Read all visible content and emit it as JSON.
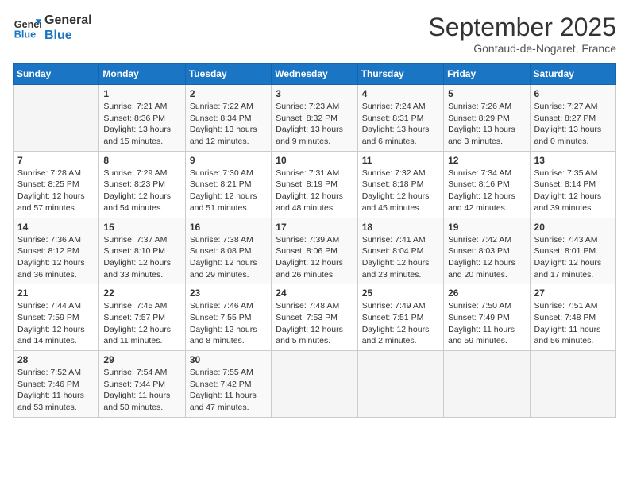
{
  "header": {
    "logo_line1": "General",
    "logo_line2": "Blue",
    "month": "September 2025",
    "location": "Gontaud-de-Nogaret, France"
  },
  "weekdays": [
    "Sunday",
    "Monday",
    "Tuesday",
    "Wednesday",
    "Thursday",
    "Friday",
    "Saturday"
  ],
  "weeks": [
    [
      {
        "day": "",
        "info": ""
      },
      {
        "day": "1",
        "info": "Sunrise: 7:21 AM\nSunset: 8:36 PM\nDaylight: 13 hours\nand 15 minutes."
      },
      {
        "day": "2",
        "info": "Sunrise: 7:22 AM\nSunset: 8:34 PM\nDaylight: 13 hours\nand 12 minutes."
      },
      {
        "day": "3",
        "info": "Sunrise: 7:23 AM\nSunset: 8:32 PM\nDaylight: 13 hours\nand 9 minutes."
      },
      {
        "day": "4",
        "info": "Sunrise: 7:24 AM\nSunset: 8:31 PM\nDaylight: 13 hours\nand 6 minutes."
      },
      {
        "day": "5",
        "info": "Sunrise: 7:26 AM\nSunset: 8:29 PM\nDaylight: 13 hours\nand 3 minutes."
      },
      {
        "day": "6",
        "info": "Sunrise: 7:27 AM\nSunset: 8:27 PM\nDaylight: 13 hours\nand 0 minutes."
      }
    ],
    [
      {
        "day": "7",
        "info": "Sunrise: 7:28 AM\nSunset: 8:25 PM\nDaylight: 12 hours\nand 57 minutes."
      },
      {
        "day": "8",
        "info": "Sunrise: 7:29 AM\nSunset: 8:23 PM\nDaylight: 12 hours\nand 54 minutes."
      },
      {
        "day": "9",
        "info": "Sunrise: 7:30 AM\nSunset: 8:21 PM\nDaylight: 12 hours\nand 51 minutes."
      },
      {
        "day": "10",
        "info": "Sunrise: 7:31 AM\nSunset: 8:19 PM\nDaylight: 12 hours\nand 48 minutes."
      },
      {
        "day": "11",
        "info": "Sunrise: 7:32 AM\nSunset: 8:18 PM\nDaylight: 12 hours\nand 45 minutes."
      },
      {
        "day": "12",
        "info": "Sunrise: 7:34 AM\nSunset: 8:16 PM\nDaylight: 12 hours\nand 42 minutes."
      },
      {
        "day": "13",
        "info": "Sunrise: 7:35 AM\nSunset: 8:14 PM\nDaylight: 12 hours\nand 39 minutes."
      }
    ],
    [
      {
        "day": "14",
        "info": "Sunrise: 7:36 AM\nSunset: 8:12 PM\nDaylight: 12 hours\nand 36 minutes."
      },
      {
        "day": "15",
        "info": "Sunrise: 7:37 AM\nSunset: 8:10 PM\nDaylight: 12 hours\nand 33 minutes."
      },
      {
        "day": "16",
        "info": "Sunrise: 7:38 AM\nSunset: 8:08 PM\nDaylight: 12 hours\nand 29 minutes."
      },
      {
        "day": "17",
        "info": "Sunrise: 7:39 AM\nSunset: 8:06 PM\nDaylight: 12 hours\nand 26 minutes."
      },
      {
        "day": "18",
        "info": "Sunrise: 7:41 AM\nSunset: 8:04 PM\nDaylight: 12 hours\nand 23 minutes."
      },
      {
        "day": "19",
        "info": "Sunrise: 7:42 AM\nSunset: 8:03 PM\nDaylight: 12 hours\nand 20 minutes."
      },
      {
        "day": "20",
        "info": "Sunrise: 7:43 AM\nSunset: 8:01 PM\nDaylight: 12 hours\nand 17 minutes."
      }
    ],
    [
      {
        "day": "21",
        "info": "Sunrise: 7:44 AM\nSunset: 7:59 PM\nDaylight: 12 hours\nand 14 minutes."
      },
      {
        "day": "22",
        "info": "Sunrise: 7:45 AM\nSunset: 7:57 PM\nDaylight: 12 hours\nand 11 minutes."
      },
      {
        "day": "23",
        "info": "Sunrise: 7:46 AM\nSunset: 7:55 PM\nDaylight: 12 hours\nand 8 minutes."
      },
      {
        "day": "24",
        "info": "Sunrise: 7:48 AM\nSunset: 7:53 PM\nDaylight: 12 hours\nand 5 minutes."
      },
      {
        "day": "25",
        "info": "Sunrise: 7:49 AM\nSunset: 7:51 PM\nDaylight: 12 hours\nand 2 minutes."
      },
      {
        "day": "26",
        "info": "Sunrise: 7:50 AM\nSunset: 7:49 PM\nDaylight: 11 hours\nand 59 minutes."
      },
      {
        "day": "27",
        "info": "Sunrise: 7:51 AM\nSunset: 7:48 PM\nDaylight: 11 hours\nand 56 minutes."
      }
    ],
    [
      {
        "day": "28",
        "info": "Sunrise: 7:52 AM\nSunset: 7:46 PM\nDaylight: 11 hours\nand 53 minutes."
      },
      {
        "day": "29",
        "info": "Sunrise: 7:54 AM\nSunset: 7:44 PM\nDaylight: 11 hours\nand 50 minutes."
      },
      {
        "day": "30",
        "info": "Sunrise: 7:55 AM\nSunset: 7:42 PM\nDaylight: 11 hours\nand 47 minutes."
      },
      {
        "day": "",
        "info": ""
      },
      {
        "day": "",
        "info": ""
      },
      {
        "day": "",
        "info": ""
      },
      {
        "day": "",
        "info": ""
      }
    ]
  ]
}
